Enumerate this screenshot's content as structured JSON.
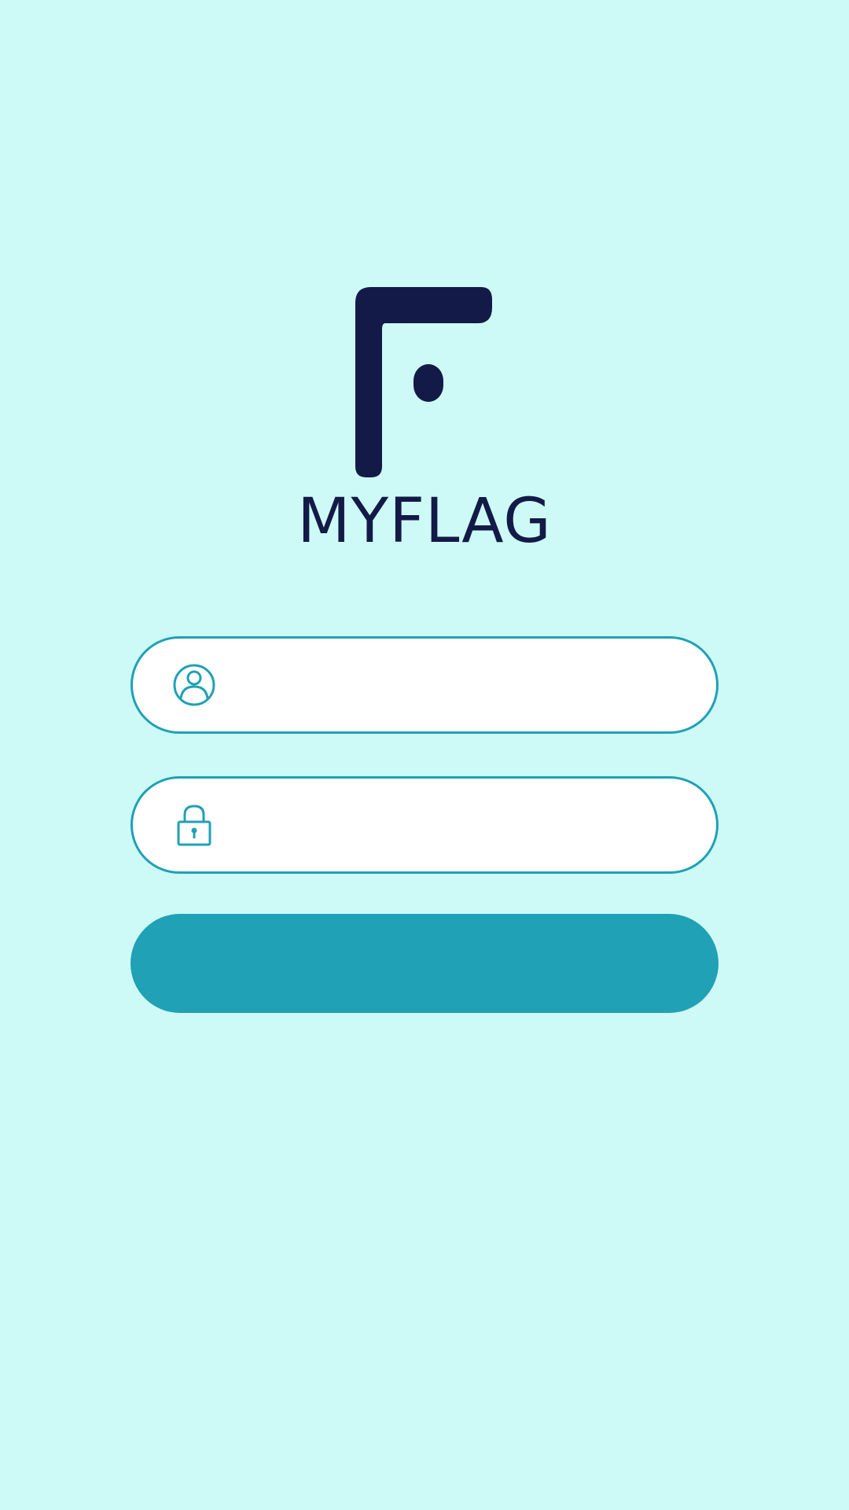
{
  "app": {
    "brand_name": "MYFLAG",
    "logo_icon": "myflag-logo-icon"
  },
  "login_form": {
    "username": {
      "icon": "user-icon",
      "value": "",
      "placeholder": ""
    },
    "password": {
      "icon": "lock-icon",
      "value": "",
      "placeholder": ""
    },
    "submit_label": ""
  },
  "colors": {
    "background": "#cdfaf6",
    "brand_dark": "#131a48",
    "accent": "#20a1b5",
    "field_background": "#ffffff"
  }
}
